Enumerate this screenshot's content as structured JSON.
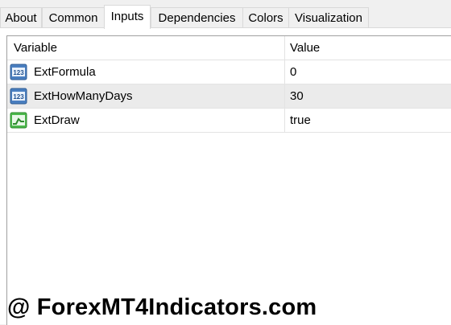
{
  "tabs": [
    {
      "label": "About"
    },
    {
      "label": "Common"
    },
    {
      "label": "Inputs",
      "active": true
    },
    {
      "label": "Dependencies"
    },
    {
      "label": "Colors"
    },
    {
      "label": "Visualization"
    }
  ],
  "grid": {
    "header": {
      "variable": "Variable",
      "value": "Value"
    },
    "rows": [
      {
        "icon": "integer-icon",
        "variable": "ExtFormula",
        "value": "0"
      },
      {
        "icon": "integer-icon",
        "variable": "ExtHowManyDays",
        "value": "30",
        "selected": true
      },
      {
        "icon": "boolean-icon",
        "variable": "ExtDraw",
        "value": "true"
      }
    ]
  },
  "watermark": {
    "text": "@ ForexMT4Indicators.com"
  },
  "colors": {
    "selected_row": "#ebebeb",
    "grid_line": "#e3e3e3",
    "integer_icon": "#3a6fb0",
    "boolean_icon": "#3aa83a"
  }
}
